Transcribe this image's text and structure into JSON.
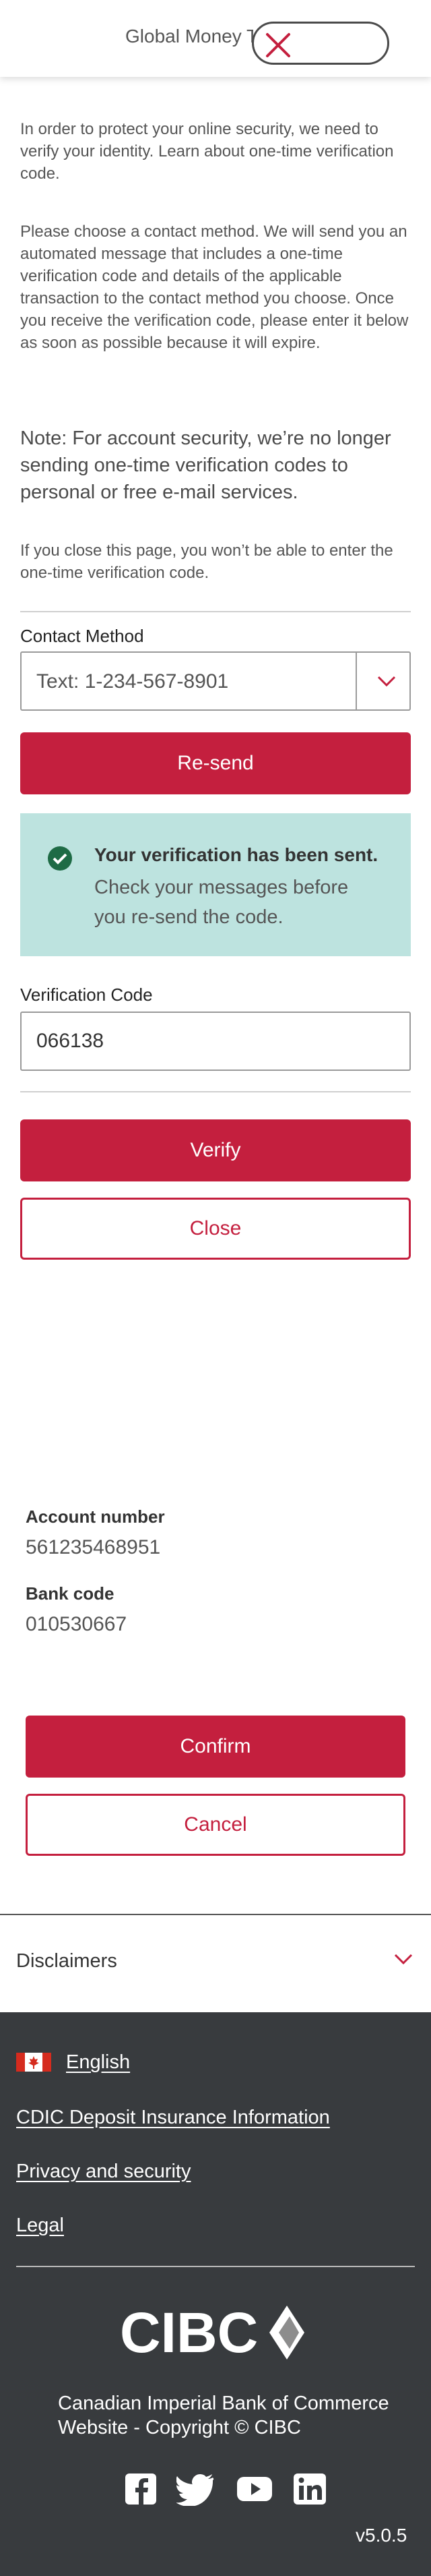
{
  "header": {
    "title": "Global Money Transfer"
  },
  "verification": {
    "intro": "In order to protect your online security, we need to verify your identity. Learn about one-time verification code.",
    "instructions": "Please choose a contact method. We will send you an automated message that includes a one-time verification code and details of the applicable transaction to the contact method you choose. Once you receive the verification code, please enter it below as soon as possible because it will expire.",
    "note": "Note: For account security, we’re no longer sending one-time verification codes to personal or free e-mail services.",
    "close_warning": "If you close this page, you won’t be able to enter the one-time verification code.",
    "contact_method_label": "Contact Method",
    "contact_method_value": "Text: 1-234-567-8901",
    "resend_label": "Re-send",
    "success_title": "Your verification has been sent.",
    "success_body": "Check your messages before you re-send the code.",
    "code_label": "Verification Code",
    "code_value": "066138",
    "verify_label": "Verify",
    "close_label": "Close"
  },
  "account": {
    "number_label": "Account number",
    "number_value": "561235468951",
    "bank_code_label": "Bank code",
    "bank_code_value": "010530667",
    "confirm_label": "Confirm",
    "cancel_label": "Cancel"
  },
  "disclaimers": {
    "title": "Disclaimers"
  },
  "footer": {
    "language": "English",
    "links": [
      "CDIC Deposit Insurance Information",
      "Privacy and security",
      "Legal"
    ],
    "logo_text": "CIBC",
    "copyright_line1": "Canadian Imperial Bank of Commerce",
    "copyright_line2": "Website - Copyright © CIBC",
    "social_icons": [
      "facebook-icon",
      "twitter-icon",
      "youtube-icon",
      "linkedin-icon"
    ],
    "version": "v5.0.5"
  },
  "colors": {
    "brand_red": "#c41f3e",
    "success_bg": "#bde3df",
    "success_icon": "#1e6b45",
    "footer_bg": "#383b3e"
  }
}
